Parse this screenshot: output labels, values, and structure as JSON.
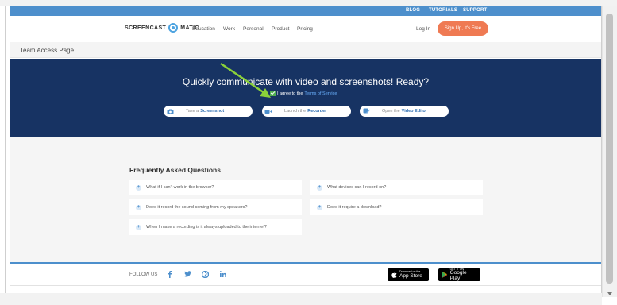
{
  "utility_nav": {
    "blog": "BLOG",
    "tutorials": "TUTORIALS",
    "support": "SUPPORT"
  },
  "brand": {
    "left": "SCREENCAST",
    "right": "MATIC"
  },
  "main_nav": {
    "items": [
      "Education",
      "Work",
      "Personal",
      "Product",
      "Pricing"
    ],
    "login": "Log In",
    "signup": "Sign Up, It's Free"
  },
  "breadcrumb": {
    "title": "Team Access Page"
  },
  "hero": {
    "title": "Quickly communicate with video and screenshots! Ready?",
    "agree_prefix": "I agree to the",
    "agree_link": "Terms of Service",
    "agree_checked": true,
    "buttons": [
      {
        "prefix": "Take a",
        "strong": "Screenshot",
        "icon": "camera-icon"
      },
      {
        "prefix": "Launch the",
        "strong": "Recorder",
        "icon": "video-camera-icon"
      },
      {
        "prefix": "Open the",
        "strong": "Video Editor",
        "icon": "edit-icon"
      }
    ]
  },
  "faq": {
    "title": "Frequently Asked Questions",
    "items": [
      "What if I can't work in the browser?",
      "What devices can I record on?",
      "Does it record the sound coming from my speakers?",
      "Does it require a download?",
      "When I make a recording is it always uploaded to the internet?"
    ]
  },
  "footer": {
    "follow_us": "FOLLOW US",
    "social": [
      "facebook-icon",
      "twitter-icon",
      "pinterest-icon",
      "linkedin-icon"
    ],
    "app_store": {
      "small": "Download on the",
      "big": "App Store"
    },
    "google_play": {
      "small": "GET IT ON",
      "big": "Google Play"
    }
  },
  "colors": {
    "utility_bar": "#4d8fcc",
    "hero_bg": "#173363",
    "signup": "#ef7a53",
    "annotation_arrow": "#8bd13a"
  }
}
